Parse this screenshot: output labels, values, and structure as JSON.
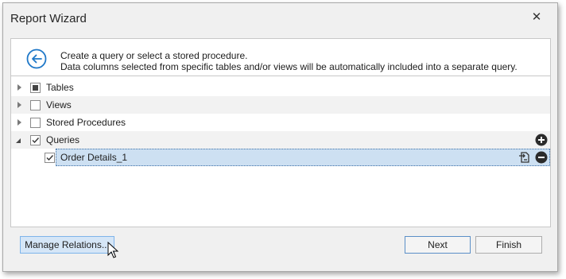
{
  "window": {
    "title": "Report Wizard",
    "close_glyph": "✕"
  },
  "header": {
    "back_icon": "arrow-left-circle-icon",
    "line1": "Create a query or select a stored procedure.",
    "line2": "Data columns selected from specific tables and/or views will be automatically included into a separate query."
  },
  "tree": {
    "items": [
      {
        "label": "Tables",
        "check": "indeterminate",
        "expander": "collapsed"
      },
      {
        "label": "Views",
        "check": "unchecked",
        "expander": "collapsed"
      },
      {
        "label": "Stored Procedures",
        "check": "unchecked",
        "expander": "collapsed"
      },
      {
        "label": "Queries",
        "check": "checked",
        "expander": "expanded",
        "action_icon": "add-circle-icon"
      },
      {
        "label": "Order Details_1",
        "check": "checked",
        "selected": true,
        "action_icons": [
          "edit-query-icon",
          "remove-circle-icon"
        ]
      }
    ]
  },
  "footer": {
    "manage_relations_label": "Manage Relations...",
    "next_label": "Next",
    "finish_label": "Finish"
  },
  "colors": {
    "accent": "#1f78c8",
    "selection": "#cde0f2",
    "hover_button": "#d5e6f7"
  }
}
